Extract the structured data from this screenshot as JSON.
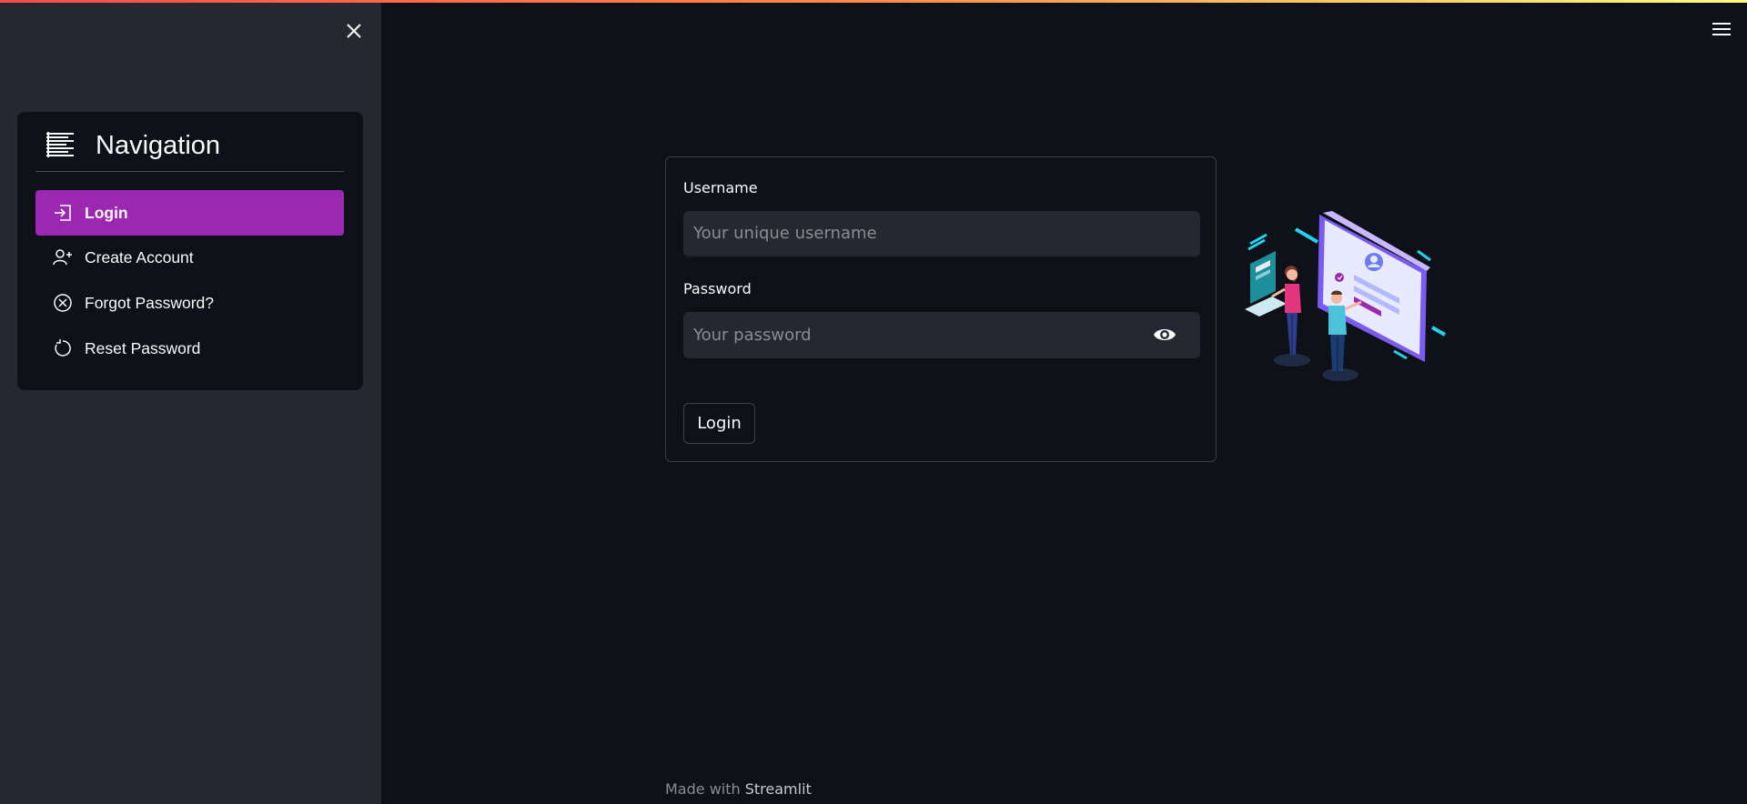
{
  "sidebar": {
    "nav_title": "Navigation",
    "items": [
      {
        "label": "Login",
        "icon": "login-icon",
        "active": true
      },
      {
        "label": "Create Account",
        "icon": "person-add-icon",
        "active": false
      },
      {
        "label": "Forgot Password?",
        "icon": "x-circle-icon",
        "active": false
      },
      {
        "label": "Reset Password",
        "icon": "arrow-clockwise-icon",
        "active": false
      }
    ]
  },
  "form": {
    "username_label": "Username",
    "username_placeholder": "Your unique username",
    "password_label": "Password",
    "password_placeholder": "Your password",
    "submit_label": "Login"
  },
  "footer": {
    "made_with": "Made with ",
    "brand": "Streamlit"
  },
  "colors": {
    "accent": "#9c27b0",
    "background": "#0e1117",
    "sidebar": "#262730",
    "input": "#262730"
  }
}
